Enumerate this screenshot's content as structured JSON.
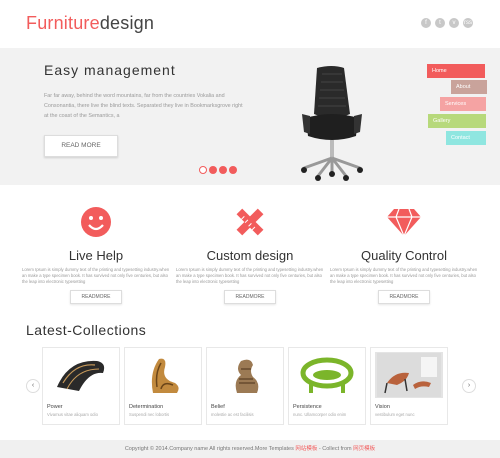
{
  "header": {
    "logo_part1": "Furniture",
    "logo_part2": "design",
    "social": [
      "f",
      "t",
      "v",
      "rss"
    ]
  },
  "colors": {
    "accent": "#f25c5c",
    "nav": [
      "#f25c5c",
      "#c9a39b",
      "#f5a3a3",
      "#b7d97b",
      "#8fe6e0"
    ]
  },
  "nav": [
    "Home",
    "About",
    "Services",
    "Gallery",
    "Contact"
  ],
  "hero": {
    "title": "Easy management",
    "text": "Far far away, behind the word mountains, far from the countries Vokalia and Consonantia, there live the blind texts. Separated they live in Bookmarksgrove right at the coast of the Semantics, a",
    "button": "READ MORE",
    "slides": 4,
    "active_slide": 0
  },
  "features": [
    {
      "icon": "smiley-icon",
      "title": "Live Help",
      "text": "Lorem Ipsum is simply dummy text of the printing and typesetting industry.when an make a type specimen book. It has survived not only five centuries, but also the leap into electronic typesetting",
      "button": "READMORE"
    },
    {
      "icon": "pencil-ruler-icon",
      "title": "Custom design",
      "text": "Lorem Ipsum is simply dummy text of the printing and typesetting industry.when an make a type specimen book. It has survived not only five centuries, but also the leap into electronic typesetting",
      "button": "READMORE"
    },
    {
      "icon": "diamond-icon",
      "title": "Quality Control",
      "text": "Lorem Ipsum is simply dummy text of the printing and typesetting industry.when an make a type specimen book. It has survived not only five centuries, but also the leap into electronic typesetting",
      "button": "READMORE"
    }
  ],
  "collections": {
    "title": "Latest-Collections",
    "prev": "‹",
    "next": "›",
    "items": [
      {
        "name": "Power",
        "desc": "Vivamus vitae aliquam odio"
      },
      {
        "name": "Determination",
        "desc": "Suspendi nec lobortis"
      },
      {
        "name": "Belief",
        "desc": "molestie ac est facilisis"
      },
      {
        "name": "Persistence",
        "desc": "nunc. Ullamcorper odio enim"
      },
      {
        "name": "Vision",
        "desc": "vestibulum eget nunc"
      }
    ]
  },
  "footer": {
    "text": "Copyright © 2014.Company name All rights reserved.More Templates",
    "link1": "网站模板",
    "mid": " - Collect from",
    "link2": "网页模板"
  }
}
